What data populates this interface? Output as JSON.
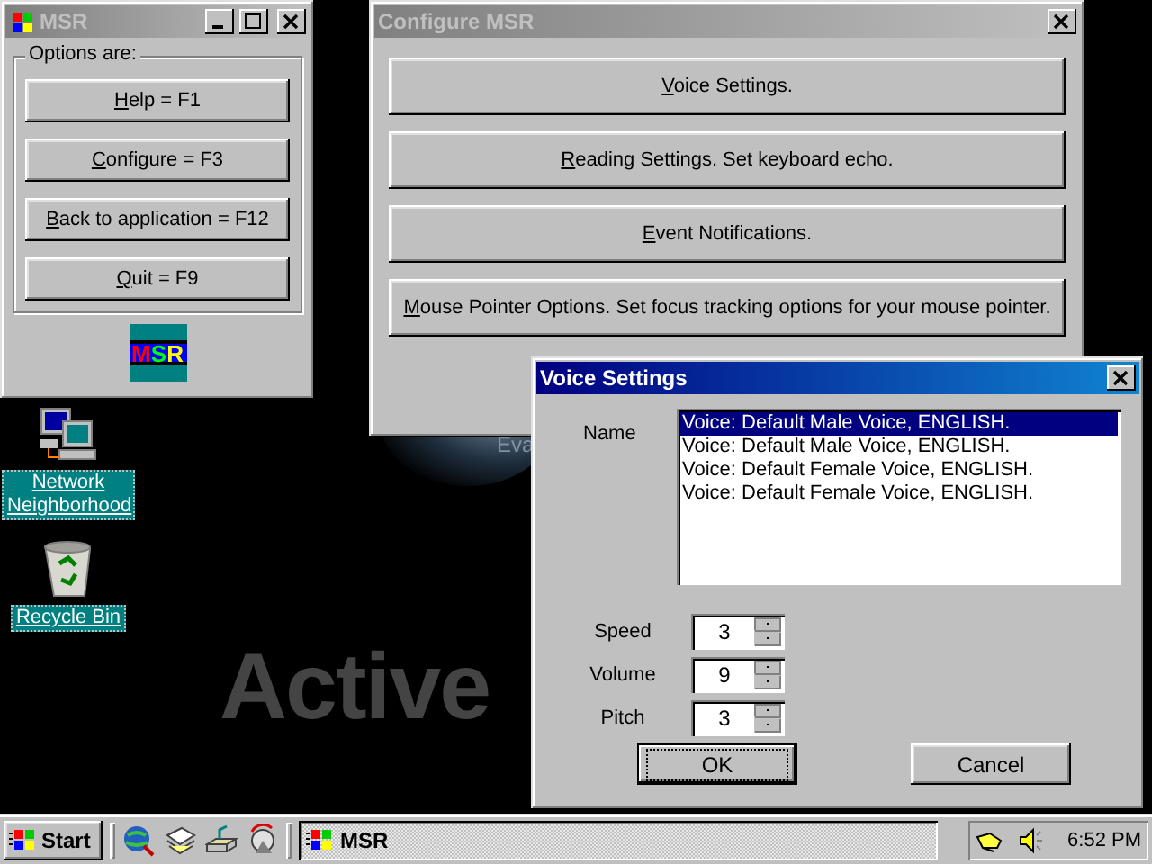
{
  "desktop": {
    "icons": [
      {
        "label": "Network Neighborhood",
        "kind": "network"
      },
      {
        "label": "Recycle Bin",
        "kind": "recycle"
      }
    ],
    "wallpaper": {
      "texts": [
        "Eva",
        "Active"
      ]
    }
  },
  "msr_window": {
    "title": "MSR",
    "active": false,
    "group_label": "Options are:",
    "logo": "MSR",
    "buttons": [
      {
        "label": "Help = F1"
      },
      {
        "label": "Configure = F3"
      },
      {
        "label": "Back to application = F12"
      },
      {
        "label": "Quit = F9"
      }
    ]
  },
  "configure_window": {
    "title": "Configure MSR",
    "active": false,
    "buttons": [
      {
        "label": "Voice Settings."
      },
      {
        "label": "Reading Settings.  Set keyboard echo."
      },
      {
        "label": "Event Notifications."
      },
      {
        "label": "Mouse Pointer Options. Set focus tracking options for your mouse pointer."
      }
    ]
  },
  "voice_window": {
    "title": "Voice Settings",
    "active": true,
    "name_label": "Name",
    "voices": [
      {
        "label": "Voice: Default Male Voice, ENGLISH.",
        "selected": true
      },
      {
        "label": "Voice: Default Male Voice, ENGLISH.",
        "selected": false
      },
      {
        "label": "Voice: Default Female Voice, ENGLISH.",
        "selected": false
      },
      {
        "label": "Voice: Default Female Voice, ENGLISH.",
        "selected": false
      }
    ],
    "settings": [
      {
        "label": "Speed",
        "value": "3"
      },
      {
        "label": "Volume",
        "value": "9"
      },
      {
        "label": "Pitch",
        "value": "3"
      }
    ],
    "buttons": [
      {
        "label": "OK",
        "default": true
      },
      {
        "label": "Cancel",
        "default": false
      }
    ]
  },
  "taskbar": {
    "start": "Start",
    "tasks": [
      {
        "label": "MSR",
        "selected": true
      }
    ],
    "clock": "6:52 PM"
  }
}
